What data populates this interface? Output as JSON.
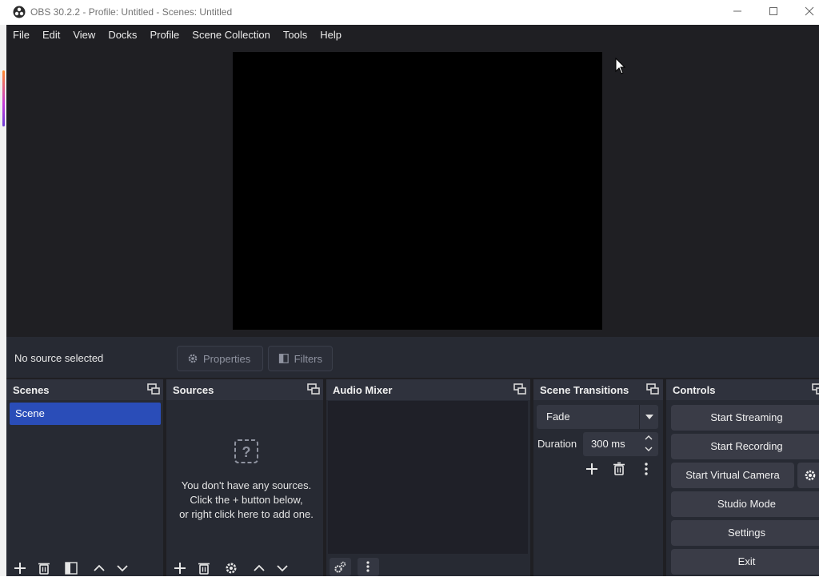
{
  "window": {
    "title": "OBS 30.2.2 - Profile: Untitled - Scenes: Untitled",
    "controls": [
      "minimize",
      "maximize",
      "close"
    ]
  },
  "menubar": {
    "items": [
      "File",
      "Edit",
      "View",
      "Docks",
      "Profile",
      "Scene Collection",
      "Tools",
      "Help"
    ]
  },
  "source_toolbar": {
    "status": "No source selected",
    "properties_label": "Properties",
    "filters_label": "Filters"
  },
  "docks": {
    "scenes": {
      "title": "Scenes",
      "items": [
        "Scene"
      ]
    },
    "sources": {
      "title": "Sources",
      "empty_lines": [
        "You don't have any sources.",
        "Click the + button below,",
        "or right click here to add one."
      ]
    },
    "audio_mixer": {
      "title": "Audio Mixer"
    },
    "scene_transitions": {
      "title": "Scene Transitions",
      "transition": "Fade",
      "duration_label": "Duration",
      "duration_value": "300 ms"
    },
    "controls": {
      "title": "Controls",
      "buttons": [
        "Start Streaming",
        "Start Recording",
        "Start Virtual Camera",
        "Studio Mode",
        "Settings",
        "Exit"
      ]
    }
  },
  "colors": {
    "window_bg": "#1f1f23",
    "dock_bg": "#272a33",
    "dock_header": "#2f323d",
    "selection": "#2a4db8",
    "button": "#3a3c47",
    "preview": "#000000"
  }
}
